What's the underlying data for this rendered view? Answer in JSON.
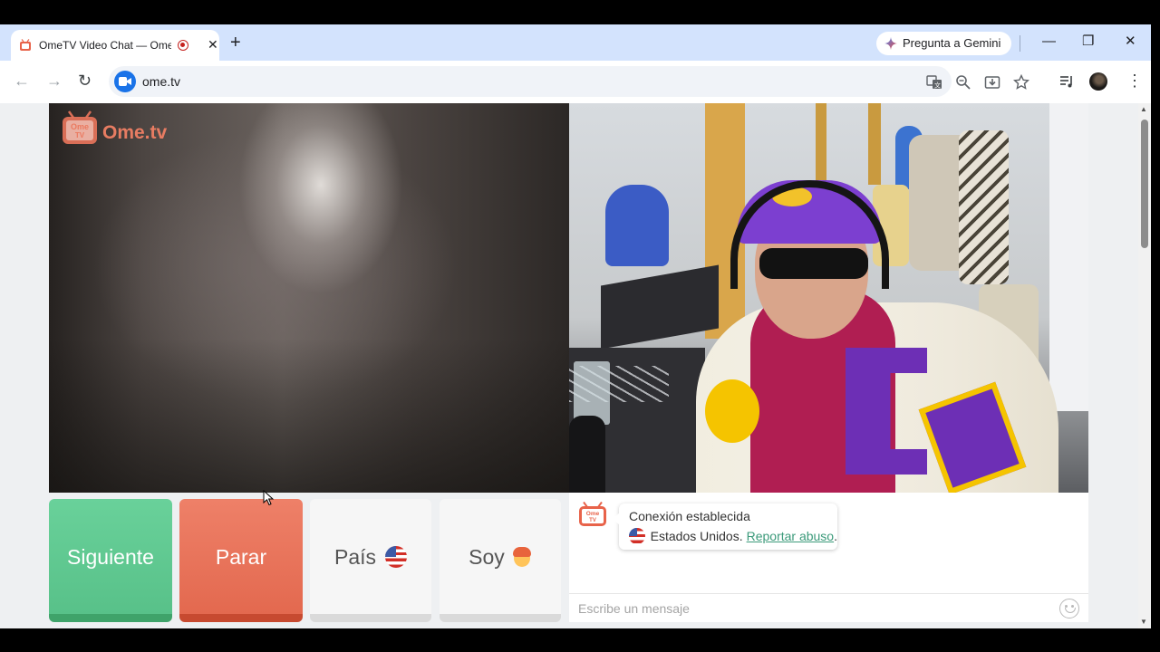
{
  "browser": {
    "tab_title": "OmeTV Video Chat — Ome",
    "tab_close_glyph": "✕",
    "new_tab_glyph": "+",
    "gemini_label": "Pregunta a Gemini",
    "window_minimize": "—",
    "window_restore": "❐",
    "window_close": "✕",
    "url": "ome.tv",
    "back_glyph": "←",
    "forward_glyph": "→",
    "reload_glyph": "↻",
    "menu_glyph": "⋮"
  },
  "page": {
    "brand_text": "Ome.tv",
    "brand_icon_text": "Ome\nTV",
    "buttons": {
      "next": "Siguiente",
      "stop": "Parar",
      "country": "País",
      "gender": "Soy"
    },
    "chat": {
      "status_title": "Conexión establecida",
      "country": "Estados Unidos.",
      "report_link": "Reportar abuso",
      "report_suffix": ".",
      "input_placeholder": "Escribe un mensaje"
    }
  },
  "colors": {
    "chrome_bg": "#d3e3fd",
    "next_button": "#5fc990",
    "stop_button": "#e9735a",
    "link": "#3b9a7a",
    "brand": "#f08064"
  },
  "icons": [
    "tab-favicon",
    "recording-icon",
    "gemini-icon",
    "back-icon",
    "forward-icon",
    "reload-icon",
    "site-icon",
    "translate-icon",
    "zoom-icon",
    "install-icon",
    "bookmark-star-icon",
    "media-icon",
    "profile-avatar",
    "menu-icon",
    "us-flag-icon",
    "boy-emoji-icon",
    "smiley-icon"
  ]
}
